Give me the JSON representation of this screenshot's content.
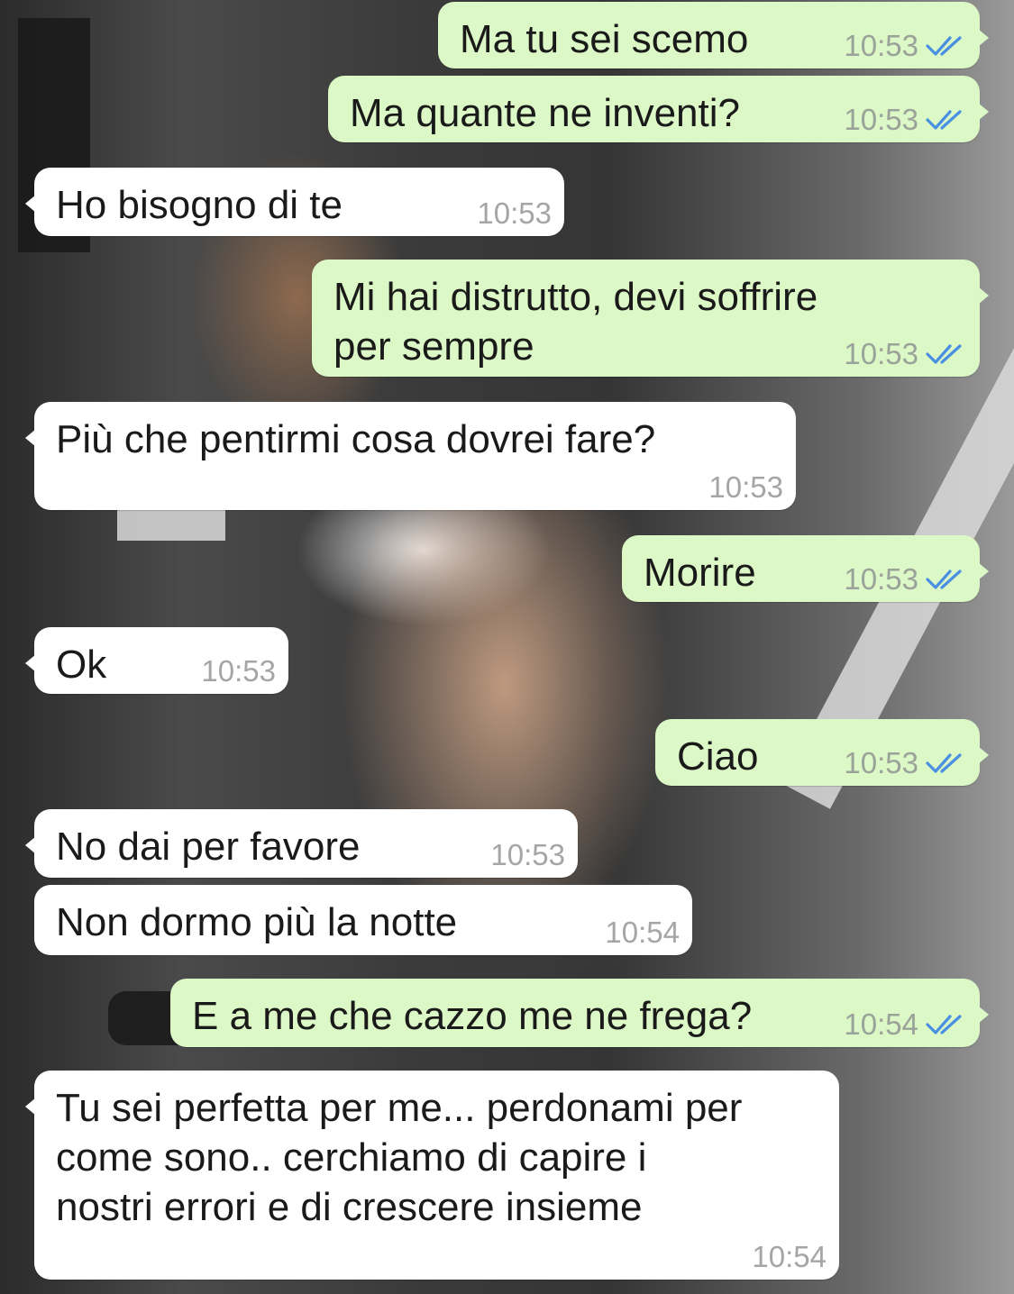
{
  "colors": {
    "incoming_bubble": "#ffffff",
    "outgoing_bubble": "#dcf8c6",
    "read_ticks": "#4a90e2",
    "timestamp": "#9aa29a"
  },
  "messages": [
    {
      "direction": "out",
      "text": "Ma tu sei scemo",
      "time": "10:53",
      "status": "read-double-tick-icon"
    },
    {
      "direction": "out",
      "text": "Ma quante ne inventi?",
      "time": "10:53",
      "status": "read-double-tick-icon"
    },
    {
      "direction": "in",
      "text": "Ho bisogno di te",
      "time": "10:53"
    },
    {
      "direction": "out",
      "text": "Mi hai distrutto, devi soffrire\nper sempre",
      "time": "10:53",
      "status": "read-double-tick-icon"
    },
    {
      "direction": "in",
      "text": "Più che pentirmi cosa dovrei fare?",
      "time": "10:53"
    },
    {
      "direction": "out",
      "text": "Morire",
      "time": "10:53",
      "status": "read-double-tick-icon"
    },
    {
      "direction": "in",
      "text": "Ok",
      "time": "10:53"
    },
    {
      "direction": "out",
      "text": "Ciao",
      "time": "10:53",
      "status": "read-double-tick-icon"
    },
    {
      "direction": "in",
      "text": "No dai per favore",
      "time": "10:53"
    },
    {
      "direction": "in",
      "text": "Non dormo più la notte",
      "time": "10:54"
    },
    {
      "direction": "out",
      "text": "E a me che cazzo me ne frega?",
      "time": "10:54",
      "status": "read-double-tick-icon"
    },
    {
      "direction": "in",
      "text": "Tu sei perfetta per me... perdonami per\ncome sono.. cerchiamo di capire i\nnostri errori e di crescere insieme",
      "time": "10:54"
    }
  ]
}
